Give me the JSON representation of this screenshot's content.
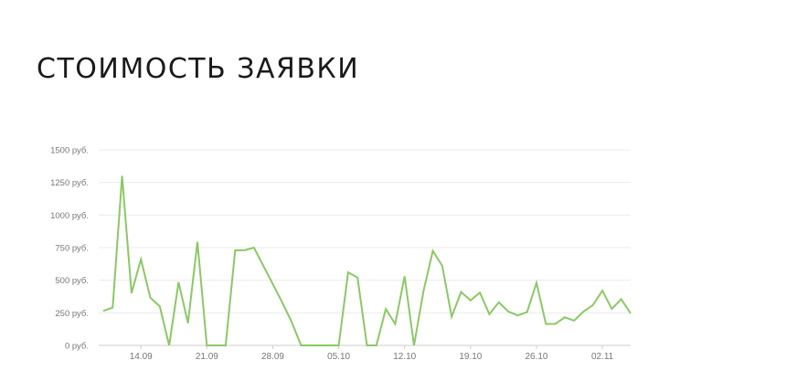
{
  "title": "СТОИМОСТЬ ЗАЯВКИ",
  "colors": {
    "line": "#8cc866",
    "grid": "#ebebeb",
    "axis": "#cccccc",
    "tick_text": "#777777",
    "title": "#1a1a1a"
  },
  "chart_data": {
    "type": "line",
    "title": "",
    "xlabel": "",
    "ylabel": "",
    "ylim": [
      0,
      1500
    ],
    "grid": true,
    "legend": "none",
    "y_ticks": [
      {
        "value": 0,
        "label": "0 руб."
      },
      {
        "value": 250,
        "label": "250 руб."
      },
      {
        "value": 500,
        "label": "500 руб."
      },
      {
        "value": 750,
        "label": "750 руб."
      },
      {
        "value": 1000,
        "label": "1000 руб."
      },
      {
        "value": 1250,
        "label": "1250 руб."
      },
      {
        "value": 1500,
        "label": "1500 руб."
      }
    ],
    "x_ticks": [
      "14.09",
      "21.09",
      "28.09",
      "05.10",
      "12.10",
      "19.10",
      "26.10",
      "02.11"
    ],
    "x": [
      "10.09",
      "11.09",
      "12.09",
      "13.09",
      "14.09",
      "15.09",
      "16.09",
      "17.09",
      "18.09",
      "19.09",
      "20.09",
      "21.09",
      "22.09",
      "23.09",
      "24.09",
      "25.09",
      "26.09",
      "27.09",
      "28.09",
      "29.09",
      "30.09",
      "01.10",
      "02.10",
      "03.10",
      "04.10",
      "05.10",
      "06.10",
      "07.10",
      "08.10",
      "09.10",
      "10.10",
      "11.10",
      "12.10",
      "13.10",
      "14.10",
      "15.10",
      "16.10",
      "17.10",
      "18.10",
      "19.10",
      "20.10",
      "21.10",
      "22.10",
      "23.10",
      "24.10",
      "25.10",
      "26.10",
      "27.10",
      "28.10",
      "29.10",
      "30.10",
      "31.10",
      "01.11",
      "02.11",
      "03.11",
      "04.11",
      "05.11"
    ],
    "series": [
      {
        "values": [
          265,
          290,
          1300,
          400,
          660,
          365,
          300,
          0,
          485,
          170,
          795,
          0,
          0,
          0,
          730,
          730,
          750,
          610,
          470,
          330,
          180,
          0,
          0,
          0,
          0,
          0,
          560,
          520,
          0,
          0,
          280,
          165,
          530,
          0,
          415,
          725,
          610,
          220,
          410,
          345,
          405,
          240,
          330,
          260,
          230,
          255,
          480,
          165,
          165,
          215,
          190,
          260,
          310,
          420,
          280,
          355,
          245
        ]
      }
    ]
  }
}
